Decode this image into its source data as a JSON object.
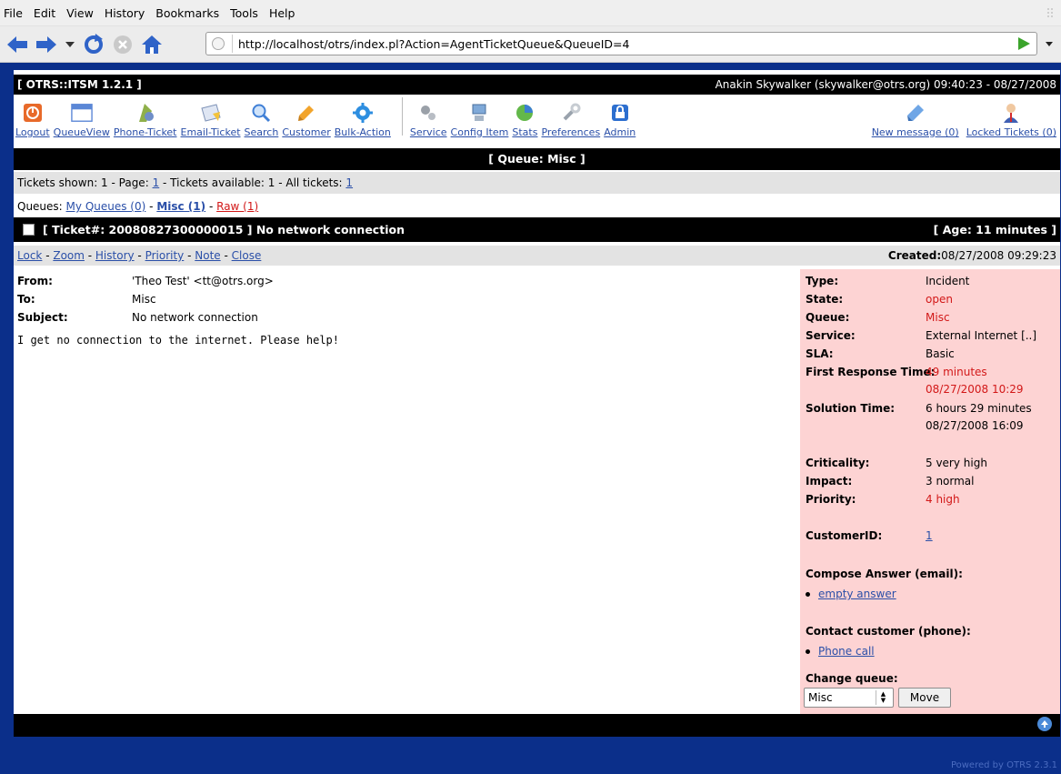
{
  "browser": {
    "menu": [
      "File",
      "Edit",
      "View",
      "History",
      "Bookmarks",
      "Tools",
      "Help"
    ],
    "url": "http://localhost/otrs/index.pl?Action=AgentTicketQueue&QueueID=4"
  },
  "header": {
    "title": "[ OTRS::ITSM 1.2.1 ]",
    "user": "Anakin Skywalker (skywalker@otrs.org) 09:40:23 - 08/27/2008"
  },
  "toolbar": {
    "left": [
      {
        "label": "Logout",
        "icon": "logout-icon"
      },
      {
        "label": "QueueView",
        "icon": "queueview-icon"
      },
      {
        "label": "Phone-Ticket",
        "icon": "phone-ticket-icon"
      },
      {
        "label": "Email-Ticket",
        "icon": "email-ticket-icon"
      },
      {
        "label": "Search",
        "icon": "search-icon"
      },
      {
        "label": "Customer",
        "icon": "customer-icon"
      },
      {
        "label": "Bulk-Action",
        "icon": "bulk-action-icon"
      }
    ],
    "middle": [
      {
        "label": "Service",
        "icon": "service-icon"
      },
      {
        "label": "Config Item",
        "icon": "config-item-icon"
      },
      {
        "label": "Stats",
        "icon": "stats-icon"
      },
      {
        "label": "Preferences",
        "icon": "preferences-icon"
      },
      {
        "label": "Admin",
        "icon": "admin-icon"
      }
    ],
    "right": [
      {
        "label": "New message (0)",
        "icon": "new-message-icon"
      },
      {
        "label": "Locked Tickets (0)",
        "icon": "locked-tickets-icon"
      }
    ]
  },
  "queue_title": "[ Queue: Misc ]",
  "tickets_info": {
    "prefix": "Tickets shown: 1 - Page:",
    "page": "1",
    "middle": "- Tickets available: 1 - All tickets:",
    "all": "1"
  },
  "queues": {
    "label": "Queues:",
    "my": "My Queues (0)",
    "misc": "Misc (1)",
    "raw": "Raw (1)",
    "sep": "-"
  },
  "ticket": {
    "title": "[ Ticket#: 20080827300000015 ] No network connection",
    "age": "[ Age: 11 minutes ]",
    "actions": [
      "Lock",
      "Zoom",
      "History",
      "Priority",
      "Note",
      "Close"
    ],
    "created_label": "Created:",
    "created": "08/27/2008 09:29:23",
    "from_label": "From:",
    "from": "'Theo Test' <tt@otrs.org>",
    "to_label": "To:",
    "to": "Misc",
    "subject_label": "Subject:",
    "subject": "No network connection",
    "body": "I get no connection to the internet. Please help!"
  },
  "side": {
    "type_l": "Type:",
    "type": "Incident",
    "state_l": "State:",
    "state": "open",
    "queue_l": "Queue:",
    "queue": "Misc",
    "service_l": "Service:",
    "service": "External Internet [..]",
    "sla_l": "SLA:",
    "sla": "Basic",
    "frt_l": "First Response Time:",
    "frt1": "49 minutes",
    "frt2": "08/27/2008 10:29",
    "sol_l": "Solution Time:",
    "sol1": "6 hours 29 minutes",
    "sol2": "08/27/2008 16:09",
    "crit_l": "Criticality:",
    "crit": "5 very high",
    "impact_l": "Impact:",
    "impact": "3 normal",
    "prio_l": "Priority:",
    "prio": "4 high",
    "cust_l": "CustomerID:",
    "cust": "1",
    "compose_l": "Compose Answer (email):",
    "compose": "empty answer",
    "contact_l": "Contact customer (phone):",
    "contact": "Phone call",
    "change_l": "Change queue:",
    "change_value": "Misc",
    "move": "Move"
  },
  "footer": "Powered by OTRS 2.3.1",
  "colors": {
    "link": "#2a4fa8",
    "red": "#d21818",
    "side_bg": "#fdd3d3",
    "page_bg": "#0b2f8a"
  }
}
